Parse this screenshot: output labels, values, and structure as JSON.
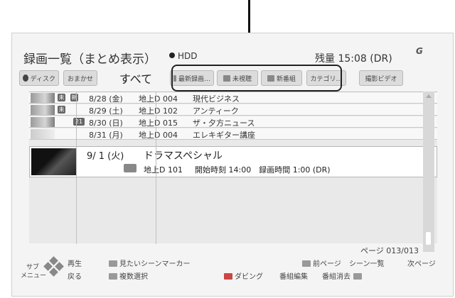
{
  "header": {
    "title": "録画一覧（まとめ表示）",
    "device": "HDD",
    "remaining": "残量 15:08 (DR)",
    "logo": "G"
  },
  "tabs": [
    {
      "label": "ディスク",
      "icon": "disc-icon"
    },
    {
      "label": "おまかせ"
    },
    {
      "label": "すべて",
      "active": true
    },
    {
      "label": "最新録画…",
      "icon": "recent-icon"
    },
    {
      "label": "未視聴",
      "icon": "unwatched-icon"
    },
    {
      "label": "新番組",
      "icon": "new-program-icon"
    },
    {
      "label": "カテゴリ…"
    },
    {
      "label": "撮影ビデオ"
    }
  ],
  "recordings": [
    {
      "date": "8/28 (金)",
      "channel": "地上D 004",
      "program": "現代ビジネス",
      "badges": [
        "未",
        "新"
      ]
    },
    {
      "date": "8/29 (土)",
      "channel": "地上D 102",
      "program": "アンティーク",
      "badges": [
        "未"
      ]
    },
    {
      "date": "8/30 (日)",
      "channel": "地上D 015",
      "program": "ザ・夕方ニュース",
      "badges": [
        "21"
      ]
    },
    {
      "date": "8/31 (月)",
      "channel": "地上D 004",
      "program": "エレキギター講座",
      "badges": []
    }
  ],
  "selected": {
    "date": "9/ 1 (火)",
    "program": "ドラマスペシャル",
    "channel": "地上D 101",
    "info": "開始時刻 14:00　録画時間 1:00 (DR)"
  },
  "page": "ページ 013/013",
  "footer": {
    "sub_menu": "サブ\nメニュー",
    "play": "再生",
    "back": "戻る",
    "scene_marker": "見たいシーンマーカー",
    "prev_page": "前ページ",
    "scene_list": "シーン一覧",
    "next_page": "次ページ",
    "multi_select": "複数選択",
    "dubbing": "ダビング",
    "edit": "番組編集",
    "delete": "番組消去"
  }
}
